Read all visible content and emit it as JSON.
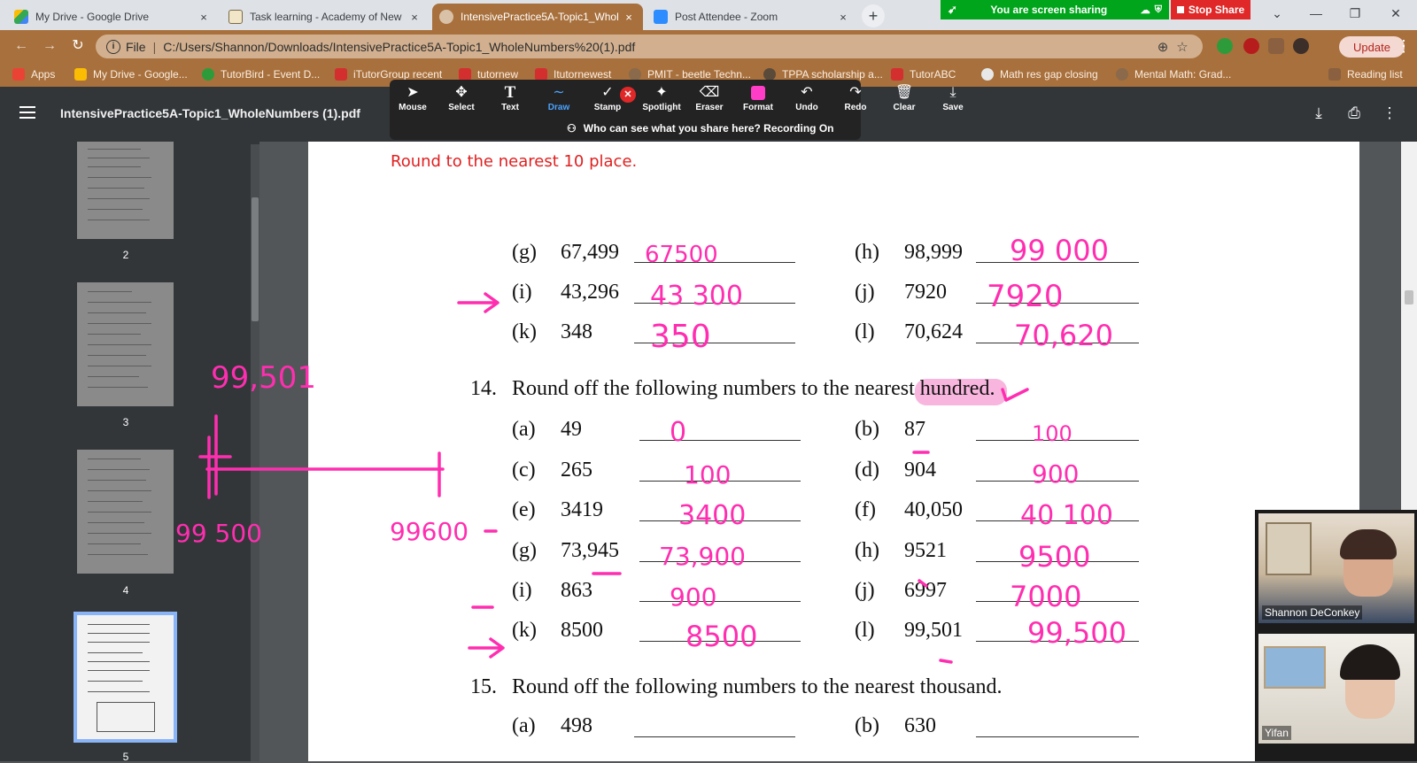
{
  "browser": {
    "tabs": [
      {
        "title": "My Drive - Google Drive",
        "close": "×"
      },
      {
        "title": "Task learning - Academy of New",
        "close": "×"
      },
      {
        "title": "IntensivePractice5A-Topic1_Whol",
        "close": "×"
      },
      {
        "title": "Post Attendee - Zoom",
        "close": "×"
      }
    ],
    "new_tab": "+",
    "url_scheme": "File",
    "url": "C:/Users/Shannon/Downloads/IntensivePractice5A-Topic1_WholeNumbers%20(1).pdf",
    "update_label": "Update",
    "bookmarks": [
      "Apps",
      "My Drive - Google...",
      "TutorBird - Event D...",
      "iTutorGroup recent",
      "tutornew",
      "Itutornewest",
      "PMIT - beetle Techn...",
      "TPPA scholarship a...",
      "TutorABC",
      "Math res gap closing",
      "Mental Math: Grad...",
      "Reading list"
    ]
  },
  "zoom": {
    "sharing_label": "You are screen sharing",
    "stop_share_label": "Stop Share",
    "tools": [
      {
        "label": "Mouse",
        "icon": "➤"
      },
      {
        "label": "Select",
        "icon": "✥"
      },
      {
        "label": "Text",
        "icon": "T"
      },
      {
        "label": "Draw",
        "icon": "∼"
      },
      {
        "label": "Stamp",
        "icon": "✓"
      },
      {
        "label": "Spotlight",
        "icon": "✦"
      },
      {
        "label": "Eraser",
        "icon": "⌫"
      },
      {
        "label": "Format",
        "icon": ""
      },
      {
        "label": "Undo",
        "icon": "↶"
      },
      {
        "label": "Redo",
        "icon": "↷"
      },
      {
        "label": "Clear",
        "icon": "🗑"
      },
      {
        "label": "Save",
        "icon": "⤓"
      }
    ],
    "active_tool": "Draw",
    "recording_notice": "Who can see what you share here? Recording On",
    "participants": [
      "Shannon DeConkey",
      "Yifan"
    ]
  },
  "pdf": {
    "title": "IntensivePractice5A-Topic1_WholeNumbers (1).pdf",
    "thumb_pages": [
      "2",
      "3",
      "4",
      "5"
    ],
    "current_page": "5",
    "note": "Round to the nearest 10 place.",
    "rows_top": [
      {
        "left_label": "(g)",
        "left_value": "67,499",
        "right_label": "(h)",
        "right_value": "98,999"
      },
      {
        "left_label": "(i)",
        "left_value": "43,296",
        "right_label": "(j)",
        "right_value": "7920"
      },
      {
        "left_label": "(k)",
        "left_value": "348",
        "right_label": "(l)",
        "right_value": "70,624"
      }
    ],
    "q14": {
      "num": "14.",
      "text": "Round off the following numbers to the nearest hundred."
    },
    "rows_14": [
      {
        "left_label": "(a)",
        "left_value": "49",
        "right_label": "(b)",
        "right_value": "87"
      },
      {
        "left_label": "(c)",
        "left_value": "265",
        "right_label": "(d)",
        "right_value": "904"
      },
      {
        "left_label": "(e)",
        "left_value": "3419",
        "right_label": "(f)",
        "right_value": "40,050"
      },
      {
        "left_label": "(g)",
        "left_value": "73,945",
        "right_label": "(h)",
        "right_value": "9521"
      },
      {
        "left_label": "(i)",
        "left_value": "863",
        "right_label": "(j)",
        "right_value": "6997"
      },
      {
        "left_label": "(k)",
        "left_value": "8500",
        "right_label": "(l)",
        "right_value": "99,501"
      }
    ],
    "q15": {
      "num": "15.",
      "text": "Round off the following numbers to the nearest thousand."
    },
    "rows_15": [
      {
        "left_label": "(a)",
        "left_value": "498",
        "right_label": "(b)",
        "right_value": "630"
      }
    ]
  },
  "ink": {
    "answers_top": [
      "67500",
      "99 000",
      "43 300",
      "7920",
      "350",
      "70,620"
    ],
    "answers_14": [
      "0",
      "100",
      "100",
      "900",
      "3400",
      "40 100",
      "73,900",
      "9500",
      "900",
      "7000",
      "8500",
      "99,500"
    ],
    "margin_notes": [
      "99,501",
      "99 500",
      "99600"
    ]
  }
}
